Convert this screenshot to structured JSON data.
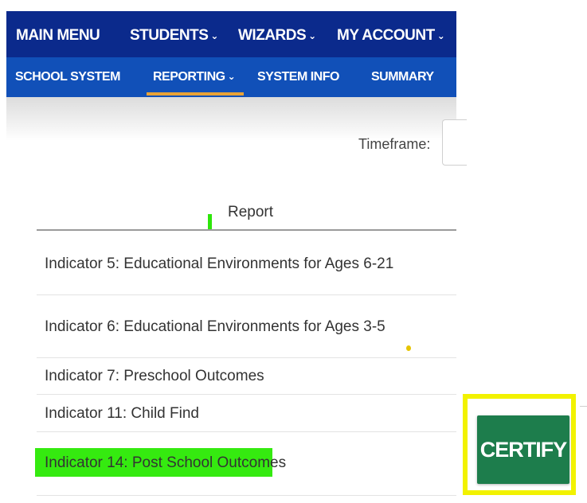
{
  "nav": {
    "main": [
      {
        "label": "MAIN MENU",
        "dropdown": false
      },
      {
        "label": "STUDENTS",
        "dropdown": true
      },
      {
        "label": "WIZARDS",
        "dropdown": true
      },
      {
        "label": "MY ACCOUNT",
        "dropdown": true
      }
    ],
    "sub": [
      {
        "label": "SCHOOL SYSTEM",
        "dropdown": false
      },
      {
        "label": "REPORTING",
        "dropdown": true,
        "active": true
      },
      {
        "label": "SYSTEM INFO",
        "dropdown": false
      },
      {
        "label": "SUMMARY",
        "dropdown": false
      }
    ],
    "chevron": "⌄"
  },
  "filters": {
    "timeframe_label": "Timeframe:"
  },
  "table": {
    "header": "Report",
    "rows": [
      "Indicator 5: Educational Environments for Ages 6-21",
      "Indicator 6: Educational Environments for Ages 3-5",
      "Indicator 7: Preschool Outcomes",
      "Indicator 11: Child Find",
      "Indicator 14: Post School Outcomes"
    ]
  },
  "actions": {
    "certify_label": "CERTIFY"
  },
  "colors": {
    "nav_top": "#0b2a8c",
    "nav_sub": "#1150b8",
    "active_underline": "#e8a236",
    "certify_button": "#1d7d4c",
    "annotation_highlight": "#35ea10",
    "annotation_frame": "#f2f200"
  }
}
